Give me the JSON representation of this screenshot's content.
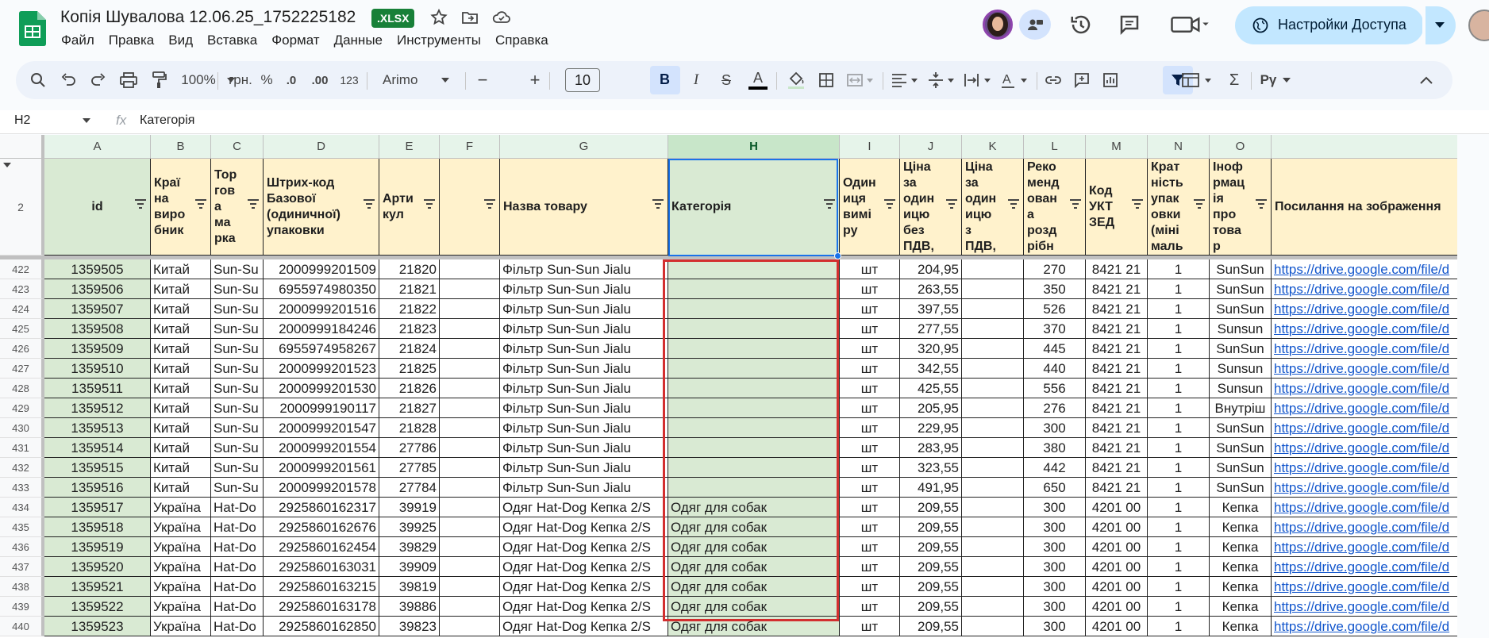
{
  "titlebar": {
    "doc_title": "Копія Шувалова 12.06.25_1752225182",
    "badge": ".XLSX",
    "share_label": "Настройки Доступа"
  },
  "menu": [
    "Файл",
    "Правка",
    "Вид",
    "Вставка",
    "Формат",
    "Данные",
    "Инструменты",
    "Справка"
  ],
  "toolbar": {
    "zoom": "100%",
    "currency": "грн.",
    "percent": "%",
    "dec_less": ".0",
    "dec_more": ".00",
    "number_format": "123",
    "font": "Arimo",
    "font_size": "10"
  },
  "formula_bar": {
    "cell_ref": "H2",
    "fx": "fx",
    "content": "Категорія"
  },
  "columns": [
    "A",
    "B",
    "C",
    "D",
    "E",
    "F",
    "G",
    "H",
    "I",
    "J",
    "K",
    "L",
    "M",
    "N",
    "O"
  ],
  "header_row_number": "2",
  "headers": [
    "id",
    "Краї\nна\nвиро\nбник",
    "Тор\nгов\nа\nма\nрка",
    "Штрих-код\nБазової\n(одиничної)\nупаковки",
    "Арти\nкул",
    "",
    "Назва товару",
    "Категорія",
    "Один\nиця\nвимі\nру",
    "Ціна\nза\nодин\nицю\nбез\nПДВ,",
    "Ціна\nза\nодин\nицю\nз\nПДВ,",
    "Реко\nменд\nован\nа\nрозд\nрібн",
    "Код\nУКТ\nЗЕД",
    "Крат\nність\nупак\nовки\n(міні\nмаль",
    "Іноф\nрмац\nія\nпро\nтова\nр",
    "Посилання на зображення"
  ],
  "rows": [
    {
      "n": "422",
      "id": "1359505",
      "country": "Китай",
      "brand": "Sun-Su",
      "barcode": "2000999201509",
      "art": "21820",
      "f": "",
      "name": "Фільтр Sun-Sun Jialu",
      "cat": "",
      "unit": "шт",
      "price": "204,95",
      "vat": "",
      "retail": "270",
      "code": "8421 21",
      "qty": "1",
      "info": "SunSun",
      "link": "https://drive.google.com/file/d"
    },
    {
      "n": "423",
      "id": "1359506",
      "country": "Китай",
      "brand": "Sun-Su",
      "barcode": "6955974980350",
      "art": "21821",
      "f": "",
      "name": "Фільтр Sun-Sun Jialu",
      "cat": "",
      "unit": "шт",
      "price": "263,55",
      "vat": "",
      "retail": "350",
      "code": "8421 21",
      "qty": "1",
      "info": "SunSun",
      "link": "https://drive.google.com/file/d"
    },
    {
      "n": "424",
      "id": "1359507",
      "country": "Китай",
      "brand": "Sun-Su",
      "barcode": "2000999201516",
      "art": "21822",
      "f": "",
      "name": "Фільтр Sun-Sun Jialu",
      "cat": "",
      "unit": "шт",
      "price": "397,55",
      "vat": "",
      "retail": "526",
      "code": "8421 21",
      "qty": "1",
      "info": "SunSun",
      "link": "https://drive.google.com/file/d"
    },
    {
      "n": "425",
      "id": "1359508",
      "country": "Китай",
      "brand": "Sun-Su",
      "barcode": "2000999184246",
      "art": "21823",
      "f": "",
      "name": "Фільтр Sun-Sun Jialu",
      "cat": "",
      "unit": "шт",
      "price": "277,55",
      "vat": "",
      "retail": "370",
      "code": "8421 21",
      "qty": "1",
      "info": "Sunsun",
      "link": "https://drive.google.com/file/d"
    },
    {
      "n": "426",
      "id": "1359509",
      "country": "Китай",
      "brand": "Sun-Su",
      "barcode": "6955974958267",
      "art": "21824",
      "f": "",
      "name": "Фільтр Sun-Sun Jialu",
      "cat": "",
      "unit": "шт",
      "price": "320,95",
      "vat": "",
      "retail": "445",
      "code": "8421 21",
      "qty": "1",
      "info": "SunSun",
      "link": "https://drive.google.com/file/d"
    },
    {
      "n": "427",
      "id": "1359510",
      "country": "Китай",
      "brand": "Sun-Su",
      "barcode": "2000999201523",
      "art": "21825",
      "f": "",
      "name": "Фільтр Sun-Sun Jialu",
      "cat": "",
      "unit": "шт",
      "price": "342,55",
      "vat": "",
      "retail": "440",
      "code": "8421 21",
      "qty": "1",
      "info": "Sunsun",
      "link": "https://drive.google.com/file/d"
    },
    {
      "n": "428",
      "id": "1359511",
      "country": "Китай",
      "brand": "Sun-Su",
      "barcode": "2000999201530",
      "art": "21826",
      "f": "",
      "name": "Фільтр Sun-Sun Jialu",
      "cat": "",
      "unit": "шт",
      "price": "425,55",
      "vat": "",
      "retail": "556",
      "code": "8421 21",
      "qty": "1",
      "info": "Sunsun",
      "link": "https://drive.google.com/file/d"
    },
    {
      "n": "429",
      "id": "1359512",
      "country": "Китай",
      "brand": "Sun-Su",
      "barcode": "2000999190117",
      "art": "21827",
      "f": "",
      "name": "Фільтр Sun-Sun Jialu",
      "cat": "",
      "unit": "шт",
      "price": "205,95",
      "vat": "",
      "retail": "276",
      "code": "8421 21",
      "qty": "1",
      "info": "Внутріш",
      "link": "https://drive.google.com/file/d"
    },
    {
      "n": "430",
      "id": "1359513",
      "country": "Китай",
      "brand": "Sun-Su",
      "barcode": "2000999201547",
      "art": "21828",
      "f": "",
      "name": "Фільтр Sun-Sun Jialu",
      "cat": "",
      "unit": "шт",
      "price": "229,95",
      "vat": "",
      "retail": "300",
      "code": "8421 21",
      "qty": "1",
      "info": "SunSun",
      "link": "https://drive.google.com/file/d"
    },
    {
      "n": "431",
      "id": "1359514",
      "country": "Китай",
      "brand": "Sun-Su",
      "barcode": "2000999201554",
      "art": "27786",
      "f": "",
      "name": "Фільтр Sun-Sun Jialu",
      "cat": "",
      "unit": "шт",
      "price": "283,95",
      "vat": "",
      "retail": "380",
      "code": "8421 21",
      "qty": "1",
      "info": "SunSun",
      "link": "https://drive.google.com/file/d"
    },
    {
      "n": "432",
      "id": "1359515",
      "country": "Китай",
      "brand": "Sun-Su",
      "barcode": "2000999201561",
      "art": "27785",
      "f": "",
      "name": "Фільтр Sun-Sun Jialu",
      "cat": "",
      "unit": "шт",
      "price": "323,55",
      "vat": "",
      "retail": "442",
      "code": "8421 21",
      "qty": "1",
      "info": "SunSun",
      "link": "https://drive.google.com/file/d"
    },
    {
      "n": "433",
      "id": "1359516",
      "country": "Китай",
      "brand": "Sun-Su",
      "barcode": "2000999201578",
      "art": "27784",
      "f": "",
      "name": "Фільтр Sun-Sun Jialu",
      "cat": "",
      "unit": "шт",
      "price": "491,95",
      "vat": "",
      "retail": "650",
      "code": "8421 21",
      "qty": "1",
      "info": "SunSun",
      "link": "https://drive.google.com/file/d"
    },
    {
      "n": "434",
      "id": "1359517",
      "country": "Україна",
      "brand": "Hat-Do",
      "barcode": "2925860162317",
      "art": "39919",
      "f": "",
      "name": "Одяг Hat-Dog Кепка 2/S",
      "cat": "Одяг для собак",
      "unit": "шт",
      "price": "209,55",
      "vat": "",
      "retail": "300",
      "code": "4201 00",
      "qty": "1",
      "info": "Кепка",
      "link": "https://drive.google.com/file/d"
    },
    {
      "n": "435",
      "id": "1359518",
      "country": "Україна",
      "brand": "Hat-Do",
      "barcode": "2925860162676",
      "art": "39925",
      "f": "",
      "name": "Одяг Hat-Dog Кепка 2/S",
      "cat": "Одяг для собак",
      "unit": "шт",
      "price": "209,55",
      "vat": "",
      "retail": "300",
      "code": "4201 00",
      "qty": "1",
      "info": "Кепка",
      "link": "https://drive.google.com/file/d"
    },
    {
      "n": "436",
      "id": "1359519",
      "country": "Україна",
      "brand": "Hat-Do",
      "barcode": "2925860162454",
      "art": "39829",
      "f": "",
      "name": "Одяг Hat-Dog Кепка 2/S",
      "cat": "Одяг для собак",
      "unit": "шт",
      "price": "209,55",
      "vat": "",
      "retail": "300",
      "code": "4201 00",
      "qty": "1",
      "info": "Кепка",
      "link": "https://drive.google.com/file/d"
    },
    {
      "n": "437",
      "id": "1359520",
      "country": "Україна",
      "brand": "Hat-Do",
      "barcode": "2925860163031",
      "art": "39909",
      "f": "",
      "name": "Одяг Hat-Dog Кепка 2/S",
      "cat": "Одяг для собак",
      "unit": "шт",
      "price": "209,55",
      "vat": "",
      "retail": "300",
      "code": "4201 00",
      "qty": "1",
      "info": "Кепка",
      "link": "https://drive.google.com/file/d"
    },
    {
      "n": "438",
      "id": "1359521",
      "country": "Україна",
      "brand": "Hat-Do",
      "barcode": "2925860163215",
      "art": "39819",
      "f": "",
      "name": "Одяг Hat-Dog Кепка 2/S",
      "cat": "Одяг для собак",
      "unit": "шт",
      "price": "209,55",
      "vat": "",
      "retail": "300",
      "code": "4201 00",
      "qty": "1",
      "info": "Кепка",
      "link": "https://drive.google.com/file/d"
    },
    {
      "n": "439",
      "id": "1359522",
      "country": "Україна",
      "brand": "Hat-Do",
      "barcode": "2925860163178",
      "art": "39886",
      "f": "",
      "name": "Одяг Hat-Dog Кепка 2/S",
      "cat": "Одяг для собак",
      "unit": "шт",
      "price": "209,55",
      "vat": "",
      "retail": "300",
      "code": "4201 00",
      "qty": "1",
      "info": "Кепка",
      "link": "https://drive.google.com/file/d"
    },
    {
      "n": "440",
      "id": "1359523",
      "country": "Україна",
      "brand": "Hat-Do",
      "barcode": "2925860162850",
      "art": "39823",
      "f": "",
      "name": "Одяг Hat-Dog Кепка 2/S",
      "cat": "Одяг для собак",
      "unit": "шт",
      "price": "209,55",
      "vat": "",
      "retail": "300",
      "code": "4201 00",
      "qty": "1",
      "info": "Кепка",
      "link": "https://drive.google.com/file/d"
    }
  ],
  "colors": {
    "header_fill": "#fff2cc",
    "category_fill": "#d9ead3",
    "id_fill": "#d9ead3",
    "column_header_fill": "#e6f4ea",
    "highlight_box": "#d32f2f",
    "selection": "#1a73e8",
    "link": "#1155cc"
  }
}
